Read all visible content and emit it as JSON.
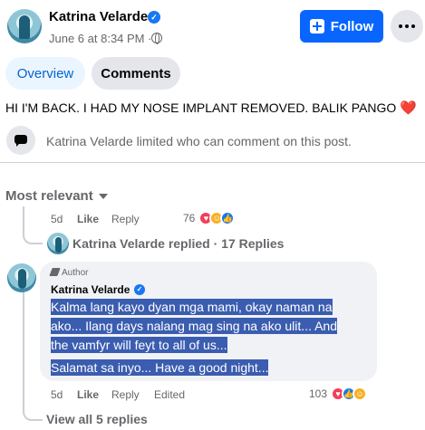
{
  "post": {
    "author": "Katrina Velarde",
    "date": "June 6 at 8:34 PM",
    "separator": "·",
    "follow_label": "Follow",
    "text": "HI I'M BACK. I HAD MY NOSE IMPLANT REMOVED. BALIK PANGO",
    "text_emoji": "❤️"
  },
  "tabs": [
    {
      "label": "Overview",
      "active": true
    },
    {
      "label": "Comments",
      "active": false
    }
  ],
  "notice": {
    "text": "Katrina Velarde limited who can comment on this post."
  },
  "sort": {
    "label": "Most relevant"
  },
  "comment1": {
    "age": "5d",
    "like": "Like",
    "reply": "Reply",
    "reaction_count": "76",
    "reactions": [
      "heart",
      "care",
      "like"
    ]
  },
  "replies_summary": {
    "text": "Katrina Velarde replied · 17 Replies"
  },
  "comment2": {
    "badge": "Author",
    "author": "Katrina Velarde",
    "paragraphs": [
      "Kalma lang kayo dyan mga mami, okay naman na ako... Ilang days nalang mag sing na ako ulit... And the vamfyr will feyt to all of us...",
      "Salamat sa inyo... Have a good night..."
    ],
    "age": "5d",
    "like": "Like",
    "reply": "Reply",
    "edited": "Edited",
    "reaction_count": "103",
    "reactions": [
      "heart",
      "like",
      "care"
    ]
  },
  "view_all": {
    "label": "View all 5 replies"
  },
  "colors": {
    "accent": "#0866ff",
    "highlight": "#3b5db0",
    "heart": "#f33e58",
    "like": "#1877f2",
    "care": "#f7b125"
  }
}
